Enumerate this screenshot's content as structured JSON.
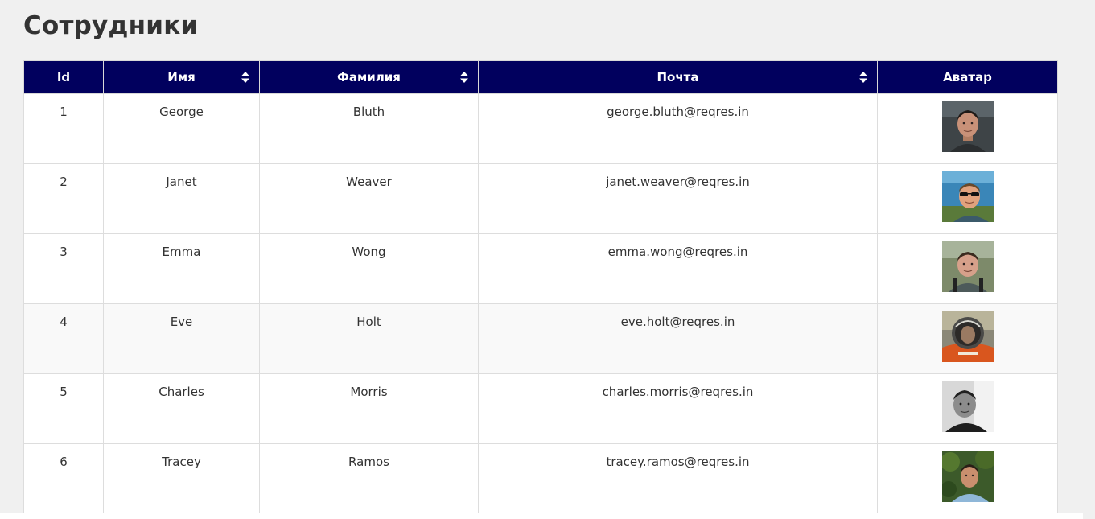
{
  "page": {
    "title": "Сотрудники"
  },
  "table": {
    "columns": [
      {
        "label": "Id",
        "sortable": false
      },
      {
        "label": "Имя",
        "sortable": true
      },
      {
        "label": "Фамилия",
        "sortable": true
      },
      {
        "label": "Почта",
        "sortable": true
      },
      {
        "label": "Аватар",
        "sortable": false
      }
    ],
    "rows": [
      {
        "id": "1",
        "first_name": "George",
        "last_name": "Bluth",
        "email": "george.bluth@reqres.in",
        "avatar_icon": "avatar-george-icon"
      },
      {
        "id": "2",
        "first_name": "Janet",
        "last_name": "Weaver",
        "email": "janet.weaver@reqres.in",
        "avatar_icon": "avatar-janet-icon"
      },
      {
        "id": "3",
        "first_name": "Emma",
        "last_name": "Wong",
        "email": "emma.wong@reqres.in",
        "avatar_icon": "avatar-emma-icon"
      },
      {
        "id": "4",
        "first_name": "Eve",
        "last_name": "Holt",
        "email": "eve.holt@reqres.in",
        "avatar_icon": "avatar-eve-icon"
      },
      {
        "id": "5",
        "first_name": "Charles",
        "last_name": "Morris",
        "email": "charles.morris@reqres.in",
        "avatar_icon": "avatar-charles-icon"
      },
      {
        "id": "6",
        "first_name": "Tracey",
        "last_name": "Ramos",
        "email": "tracey.ramos@reqres.in",
        "avatar_icon": "avatar-tracey-icon"
      }
    ]
  },
  "colors": {
    "header_bg": "#01005e",
    "header_text": "#ffffff",
    "page_bg": "#f0f0f0",
    "row_bg": "#ffffff",
    "row_alt_bg": "#f9f9f9",
    "border": "#dddddd",
    "text": "#333333"
  }
}
